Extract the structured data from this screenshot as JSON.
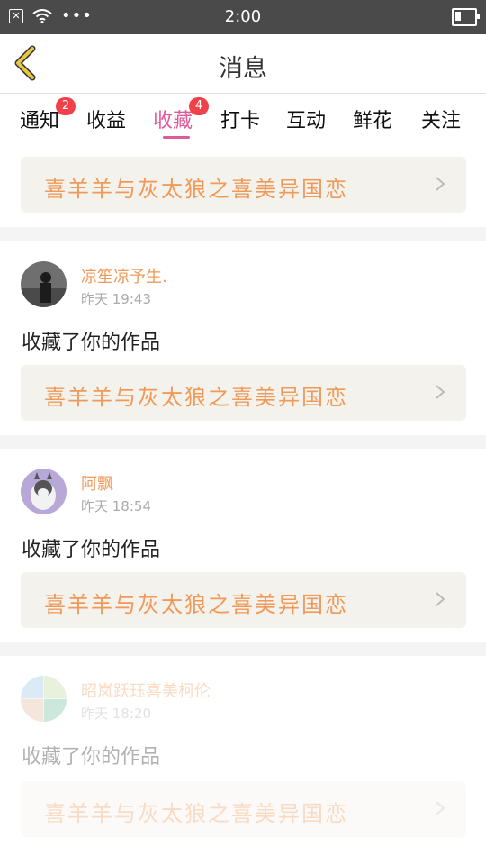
{
  "status_bar": {
    "time": "2:00",
    "battery_level": 0.4
  },
  "header": {
    "title": "消息",
    "back_icon": "chevron-left-icon"
  },
  "tabs": [
    {
      "label": "通知",
      "badge": "2",
      "active": false
    },
    {
      "label": "收益",
      "badge": "",
      "active": false
    },
    {
      "label": "收藏",
      "badge": "4",
      "active": true
    },
    {
      "label": "打卡",
      "badge": "",
      "active": false
    },
    {
      "label": "互动",
      "badge": "",
      "active": false
    },
    {
      "label": "鲜花",
      "badge": "",
      "active": false
    },
    {
      "label": "关注",
      "badge": "",
      "active": false
    }
  ],
  "top_work": {
    "title": "喜羊羊与灰太狼之喜美异国恋"
  },
  "notifications": [
    {
      "username": "凉笙凉予生.",
      "time": "昨天 19:43",
      "action": "收藏了你的作品",
      "work_title": "喜羊羊与灰太狼之喜美异国恋"
    },
    {
      "username": "阿飘",
      "time": "昨天 18:54",
      "action": "收藏了你的作品",
      "work_title": "喜羊羊与灰太狼之喜美异国恋"
    },
    {
      "username": "昭岚跃珏喜美柯伦",
      "time": "昨天 18:20",
      "action": "收藏了你的作品",
      "work_title": "喜羊羊与灰太狼之喜美异国恋"
    }
  ],
  "colors": {
    "accent_pink": "#e05a9a",
    "work_orange": "#f09a5a",
    "badge_red": "#f0404a",
    "back_yellow": "#e8c547"
  }
}
